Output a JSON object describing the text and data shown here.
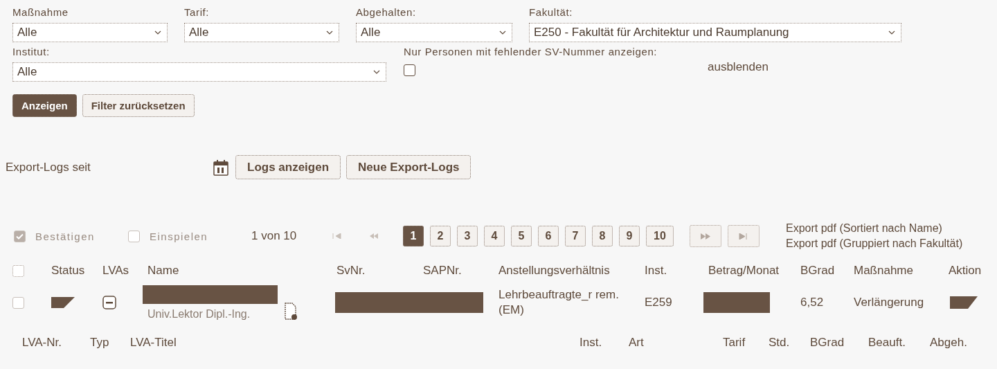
{
  "filters": [
    {
      "label": "Maßnahme",
      "value": "Alle"
    },
    {
      "label": "Tarif:",
      "value": "Alle"
    },
    {
      "label": "Abgehalten:",
      "value": "Alle"
    },
    {
      "label": "Fakultät:",
      "value": "E250 - Fakultät für Architektur und Raumplanung"
    },
    {
      "label": "Institut:",
      "value": "Alle"
    }
  ],
  "missing_sv_filter": {
    "label": "Nur Personen mit fehlender SV-Nummer anzeigen:",
    "checked": false
  },
  "toggle_link": "ausblenden",
  "filter_buttons": [
    {
      "label": "Anzeigen",
      "primary": true
    },
    {
      "label": "Filter zurücksetzen",
      "primary": false
    }
  ],
  "export_logs": {
    "label": "Export-Logs seit",
    "buttons": [
      "Logs anzeigen",
      "Neue Export-Logs"
    ]
  },
  "bulk_actions": [
    {
      "label": "Bestätigen",
      "checked": true,
      "disabled": true
    },
    {
      "label": "Einspielen",
      "checked": false,
      "disabled": true
    }
  ],
  "pager": {
    "summary": "1 von 10",
    "pages": [
      {
        "label": "1",
        "selected": true
      },
      {
        "label": "2",
        "selected": false
      },
      {
        "label": "3",
        "selected": false
      },
      {
        "label": "4",
        "selected": false
      },
      {
        "label": "5",
        "selected": false
      },
      {
        "label": "6",
        "selected": false
      },
      {
        "label": "7",
        "selected": false
      },
      {
        "label": "8",
        "selected": false
      },
      {
        "label": "9",
        "selected": false
      },
      {
        "label": "10",
        "selected": false
      }
    ]
  },
  "export_links": [
    "Export pdf (Sortiert nach Name)",
    "Export pdf (Gruppiert nach Fakultät)"
  ],
  "table": {
    "select_all_checked": false,
    "columns": [
      "Status",
      "LVAs",
      "Name",
      "SvNr.",
      "SAPNr.",
      "Anstellungsverhältnis",
      "Inst.",
      "Betrag/Monat",
      "BGrad",
      "Maßnahme",
      "Aktion"
    ],
    "rows": [
      {
        "checked": false,
        "expanded": true,
        "title": "Univ.Lektor Dipl.-Ing.",
        "employment": "Lehrbeauftragte_r rem. (EM)",
        "inst": "E259",
        "bgrad": "6,52",
        "measure": "Verlängerung"
      }
    ]
  },
  "sub_table": {
    "columns": [
      "LVA-Nr.",
      "Typ",
      "LVA-Titel",
      "Inst.",
      "Art",
      "Tarif",
      "Std.",
      "BGrad",
      "Beauft.",
      "Abgeh."
    ]
  }
}
